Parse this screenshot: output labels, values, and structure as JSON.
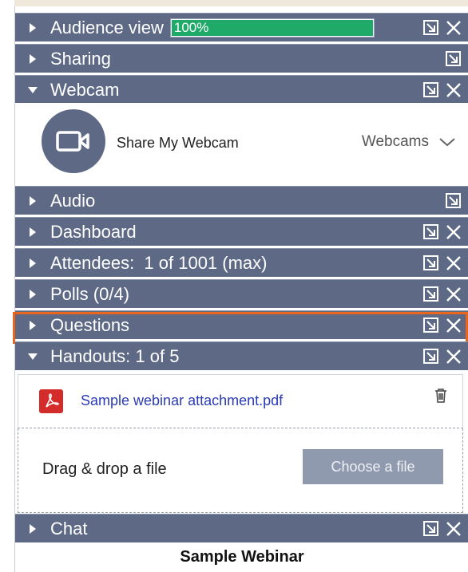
{
  "panels": {
    "audience": {
      "label": "Audience view",
      "progress_text": "100%",
      "progress": 1.0
    },
    "sharing": {
      "label": "Sharing"
    },
    "webcam": {
      "label": "Webcam",
      "share_label": "Share My Webcam",
      "select_value": "Webcams"
    },
    "audio": {
      "label": "Audio"
    },
    "dashboard": {
      "label": "Dashboard"
    },
    "attendees": {
      "label": "Attendees:  1 of 1001 (max)"
    },
    "polls": {
      "label": "Polls (0/4)"
    },
    "questions": {
      "label": "Questions"
    },
    "handouts": {
      "label": "Handouts: 1 of 5",
      "file_name": "Sample webinar attachment.pdf",
      "drop_text": "Drag & drop a file",
      "choose_label": "Choose a file"
    },
    "chat": {
      "label": "Chat"
    }
  },
  "footer": {
    "title": "Sample Webinar"
  },
  "icons": {
    "popout": "popout-icon",
    "close": "close-icon",
    "camera": "camera-icon",
    "pdf": "pdf-icon",
    "trash": "trash-icon",
    "chevron": "chevron-down-icon"
  },
  "colors": {
    "bar": "#5e6a85",
    "progress": "#1faa6a",
    "highlight": "#e8671c",
    "link": "#2a3bb5",
    "button": "#8f9aae"
  }
}
